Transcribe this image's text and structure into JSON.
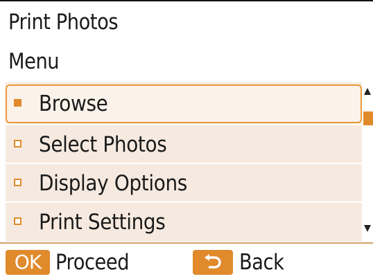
{
  "header": {
    "title": "Print Photos",
    "subtitle": "Menu"
  },
  "menu": {
    "items": [
      {
        "label": "Browse",
        "selected": true
      },
      {
        "label": "Select Photos",
        "selected": false
      },
      {
        "label": "Display Options",
        "selected": false
      },
      {
        "label": "Print Settings",
        "selected": false
      }
    ]
  },
  "footer": {
    "ok_badge": "OK",
    "ok_label": "Proceed",
    "back_icon": "back-arrow-icon",
    "back_label": "Back"
  },
  "colors": {
    "accent": "#e08a2c",
    "menu_background": "#f6eae0",
    "text": "#1a1a1a"
  }
}
